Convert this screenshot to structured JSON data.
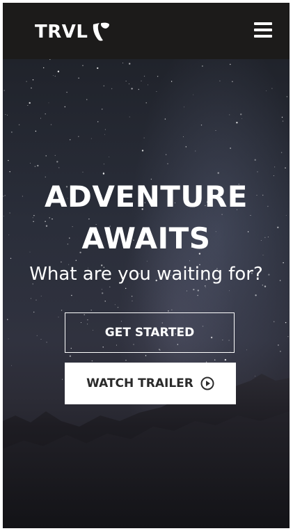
{
  "header": {
    "brand_name": "TRVL",
    "brand_logo_icon": "typo3-logo-icon",
    "menu_icon": "hamburger-menu-icon",
    "background_color": "#1c1b1a"
  },
  "hero": {
    "title_line1": "ADVENTURE",
    "title_line2": "AWAITS",
    "subtitle": "What are you waiting for?",
    "background_image": "night sky with milky way over mountains"
  },
  "buttons": {
    "primary_label": "GET STARTED",
    "secondary_label": "WATCH TRAILER",
    "secondary_icon": "play-circle-icon"
  },
  "colors": {
    "text_light": "#ffffff",
    "button_solid_bg": "#ffffff",
    "button_solid_text": "#2a2a2a"
  }
}
